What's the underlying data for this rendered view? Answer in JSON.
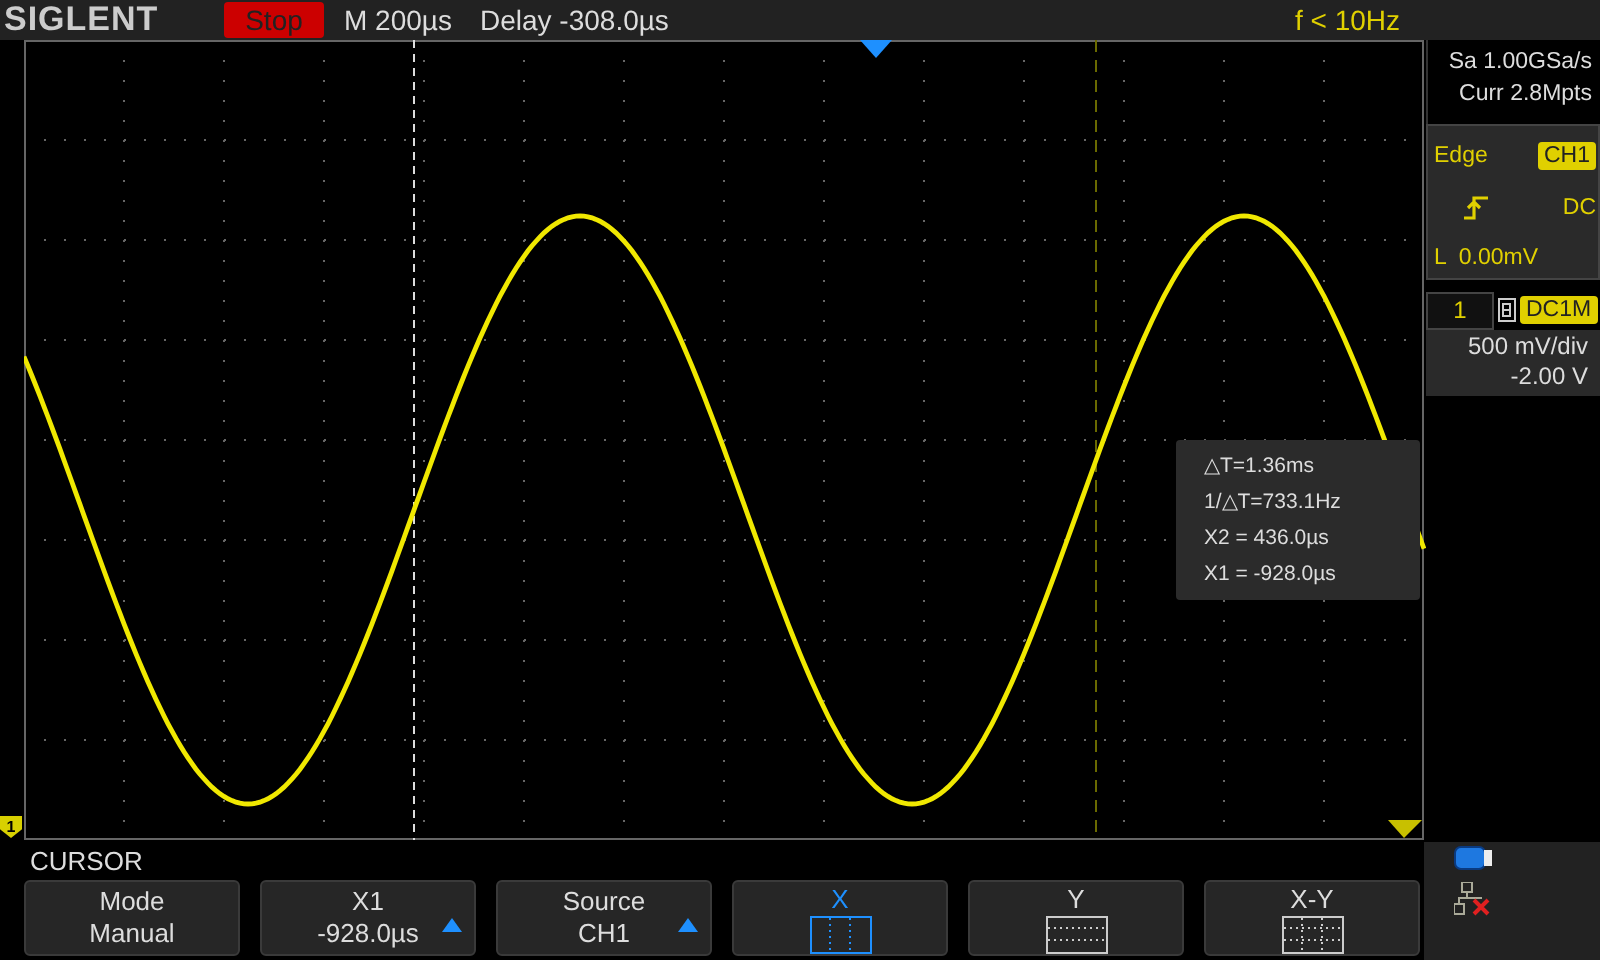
{
  "header": {
    "brand": "SIGLENT",
    "run_state": "Stop",
    "timebase": "M 200µs",
    "delay": "Delay -308.0µs",
    "trigger_frequency": "f < 10Hz"
  },
  "channel_marker": "1",
  "measurements": [
    "△T=1.36ms",
    "1/△T=733.1Hz",
    "X2 = 436.0µs",
    "X1 = -928.0µs"
  ],
  "acquisition": {
    "sample_rate": "Sa 1.00GSa/s",
    "memory_depth": "Curr 2.8Mpts"
  },
  "trigger": {
    "type": "Edge",
    "source": "CH1",
    "coupling": "DC",
    "level": "L  0.00mV"
  },
  "channel": {
    "number": "1",
    "coupling": "DC1M",
    "scale": "500 mV/div",
    "offset": "-2.00 V"
  },
  "menu": {
    "title": "CURSOR",
    "softkeys": [
      {
        "kind": "text",
        "label": "Mode",
        "value": "Manual",
        "adjustable": false
      },
      {
        "kind": "text",
        "label": "X1",
        "value": "-928.0µs",
        "adjustable": true
      },
      {
        "kind": "text",
        "label": "Source",
        "value": "CH1",
        "adjustable": true
      },
      {
        "kind": "vertical-cursors",
        "label": "X",
        "selected": true
      },
      {
        "kind": "horizontal-cursors",
        "label": "Y",
        "selected": false
      },
      {
        "kind": "cross-cursors",
        "label": "X-Y",
        "selected": false
      }
    ]
  }
}
